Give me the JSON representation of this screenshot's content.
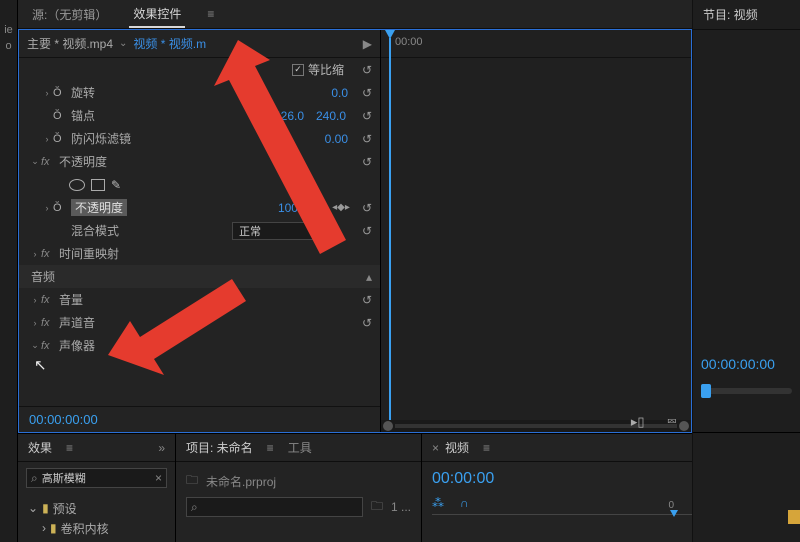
{
  "source_panel": {
    "source_tab": "源:（无剪辑）",
    "effect_controls_tab": "效果控件",
    "master_label": "主要 * 视频.mp4",
    "clip_label": "视频 * 视频.m",
    "props": {
      "scale_ratio_label": "等比缩",
      "rotation_label": "旋转",
      "rotation_value": "0.0",
      "anchor_label": "锚点",
      "anchor_x": "426.0",
      "anchor_y": "240.0",
      "antiflicker_label": "防闪烁滤镜",
      "antiflicker_value": "0.00",
      "opacity_section": "不透明度",
      "opacity_prop": "不透明度",
      "opacity_value": "100.0 %",
      "blend_label": "混合模式",
      "blend_value": "正常",
      "time_remap": "时间重映射",
      "audio_section": "音频",
      "volume": "音量",
      "channel_vol": "声道音",
      "panner": "声像器"
    },
    "timecode": "00:00:00:00",
    "timeline_time": "00:00"
  },
  "program_panel": {
    "title": "节目: 视频",
    "timecode": "00:00:00:00"
  },
  "effects_panel": {
    "title": "效果",
    "search_value": "高斯模糊",
    "preset_folder": "预设",
    "kernel_folder": "卷积内核"
  },
  "project_panel": {
    "title": "项目: 未命名",
    "tools_tab": "工具",
    "project_name": "未命名.prproj",
    "search_placeholder": "",
    "item_count": "1 ..."
  },
  "timeline_panel": {
    "title": "视频",
    "timecode": "00:00:00",
    "ruler_start": "0"
  }
}
